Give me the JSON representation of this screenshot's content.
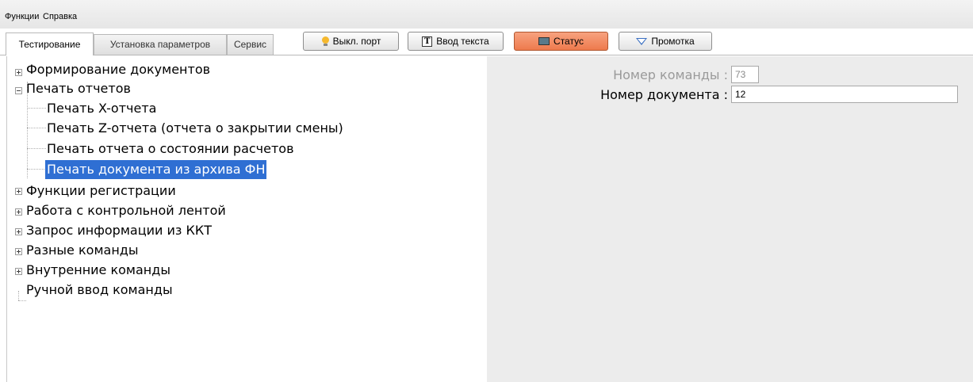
{
  "menu": {
    "items": [
      "Функции",
      "Справка"
    ]
  },
  "tabs": [
    {
      "label": "Тестирование",
      "active": true
    },
    {
      "label": "Установка параметров",
      "active": false
    },
    {
      "label": "Сервис",
      "active": false
    }
  ],
  "toolbar": {
    "port_button": "Выкл. порт",
    "text_input_button": "Ввод текста",
    "status_button": "Статус",
    "feed_button": "Промотка"
  },
  "tree": {
    "nodes": [
      {
        "label": "Формирование документов",
        "expandable": true,
        "expanded": false
      },
      {
        "label": "Печать отчетов",
        "expandable": true,
        "expanded": true
      },
      {
        "label": "Печать X-отчета"
      },
      {
        "label": "Печать Z-отчета (отчета о закрытии смены)"
      },
      {
        "label": "Печать отчета о состоянии расчетов"
      },
      {
        "label": "Печать документа из архива ФН",
        "selected": true
      },
      {
        "label": "Функции регистрации",
        "expandable": true,
        "expanded": false
      },
      {
        "label": "Работа с контрольной лентой",
        "expandable": true,
        "expanded": false
      },
      {
        "label": "Запрос информации из ККТ",
        "expandable": true,
        "expanded": false
      },
      {
        "label": "Разные команды",
        "expandable": true,
        "expanded": false
      },
      {
        "label": "Внутренние команды",
        "expandable": true,
        "expanded": false
      },
      {
        "label": "Ручной ввод команды"
      }
    ]
  },
  "form": {
    "command_label": "Номер команды :",
    "command_value": "73",
    "document_label": "Номер документа :",
    "document_value": "12"
  },
  "colors": {
    "selection": "#2f6fd3",
    "status_button": "#ee7a4d",
    "right_panel": "#ececec"
  }
}
